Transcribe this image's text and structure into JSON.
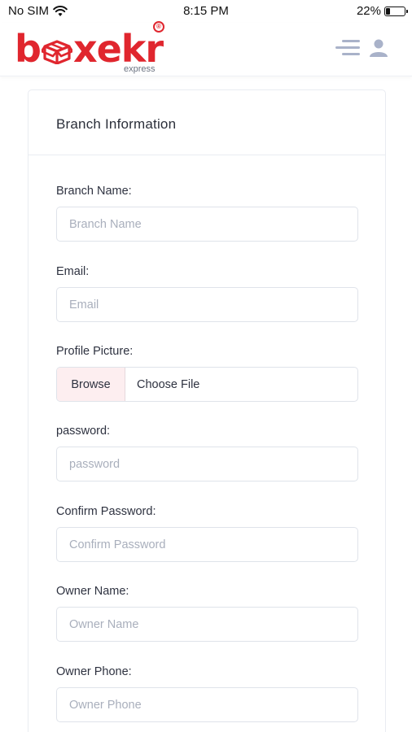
{
  "status_bar": {
    "carrier": "No SIM",
    "time": "8:15 PM",
    "battery_percent": "22%",
    "battery_level": 0.22,
    "wifi_icon": "wifi-icon"
  },
  "header": {
    "logo_text": "boxekr",
    "logo_subtext": "express",
    "logo_registered": "®",
    "menu_icon": "menu-icon",
    "user_icon": "user-icon",
    "brand_color": "#e0262e"
  },
  "form": {
    "title": "Branch Information",
    "fields": {
      "branch_name": {
        "label": "Branch Name:",
        "placeholder": "Branch Name",
        "value": ""
      },
      "email": {
        "label": "Email:",
        "placeholder": "Email",
        "value": ""
      },
      "profile_picture": {
        "label": "Profile Picture:",
        "browse_label": "Browse",
        "file_text": "Choose File"
      },
      "password": {
        "label": "password:",
        "placeholder": "password",
        "value": ""
      },
      "confirm_password": {
        "label": "Confirm Password:",
        "placeholder": "Confirm Password",
        "value": ""
      },
      "owner_name": {
        "label": "Owner Name:",
        "placeholder": "Owner Name",
        "value": ""
      },
      "owner_phone": {
        "label": "Owner Phone:",
        "placeholder": "Owner Phone",
        "value": ""
      }
    }
  }
}
